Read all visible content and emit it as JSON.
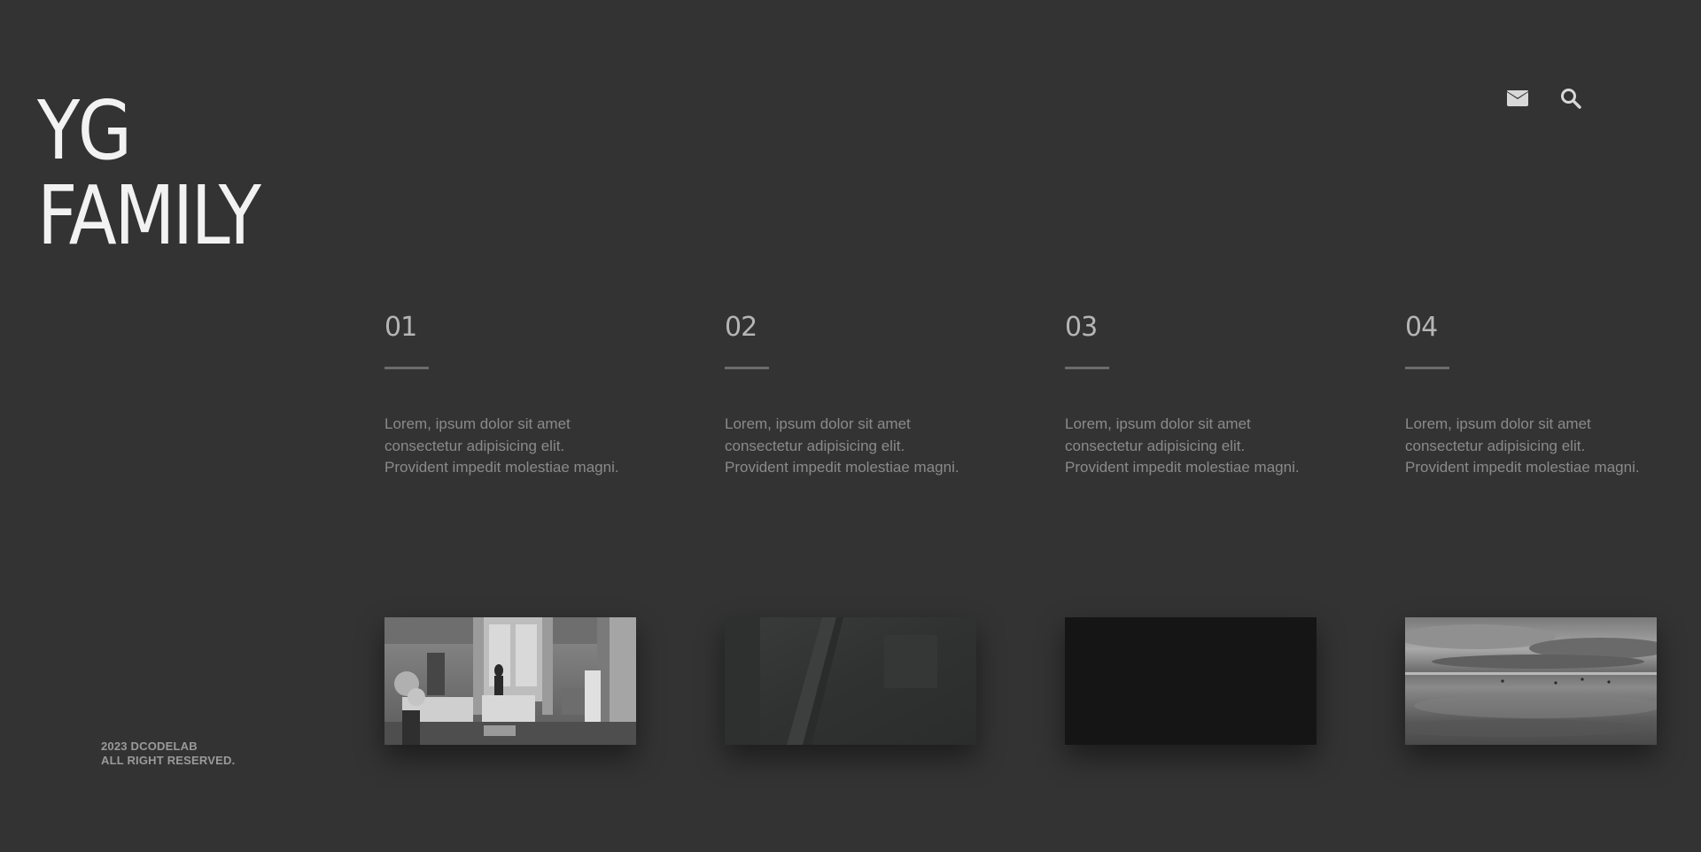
{
  "header": {
    "logo_line1": "YG",
    "logo_line2": "FAMILY",
    "icons": [
      "mail-icon",
      "search-icon"
    ]
  },
  "cards": [
    {
      "number": "01",
      "description": "Lorem, ipsum dolor sit amet\nconsectetur adipisicing elit.\nProvident impedit molestiae magni.",
      "thumbnail": "grayscale room interior with person at window"
    },
    {
      "number": "02",
      "description": "Lorem, ipsum dolor sit amet\nconsectetur adipisicing elit.\nProvident impedit molestiae magni.",
      "thumbnail": "dark blurred scene"
    },
    {
      "number": "03",
      "description": "Lorem, ipsum dolor sit amet\nconsectetur adipisicing elit.\nProvident impedit molestiae magni.",
      "thumbnail": "black frame"
    },
    {
      "number": "04",
      "description": "Lorem, ipsum dolor sit amet\nconsectetur adipisicing elit.\nProvident impedit molestiae magni.",
      "thumbnail": "grayscale sea with cloudy sky"
    }
  ],
  "footer": {
    "line1": "2023 DCODELAB",
    "line2": "ALL RIGHT RESERVED."
  },
  "colors": {
    "background": "#333333",
    "logo": "#f2f2f2",
    "number": "#b5b5b5",
    "text": "#8a8a8a",
    "accent_bar": "#6b6b6b"
  }
}
